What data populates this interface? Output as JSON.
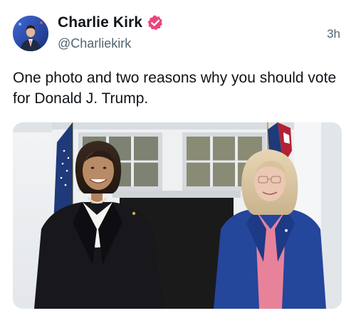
{
  "author": {
    "display_name": "Charlie Kirk",
    "handle": "@Charliekirk",
    "verified_badge": "verified-check-icon",
    "verified_color": "#e8467c"
  },
  "post": {
    "timestamp": "3h",
    "text": "One photo and two reasons why you should vote for Donald J. Trump."
  },
  "media": {
    "type": "photo",
    "subject": "two-women-standing-in-front-of-building-with-flags"
  },
  "colors": {
    "text_primary": "#0f1419",
    "text_secondary": "#536471"
  }
}
